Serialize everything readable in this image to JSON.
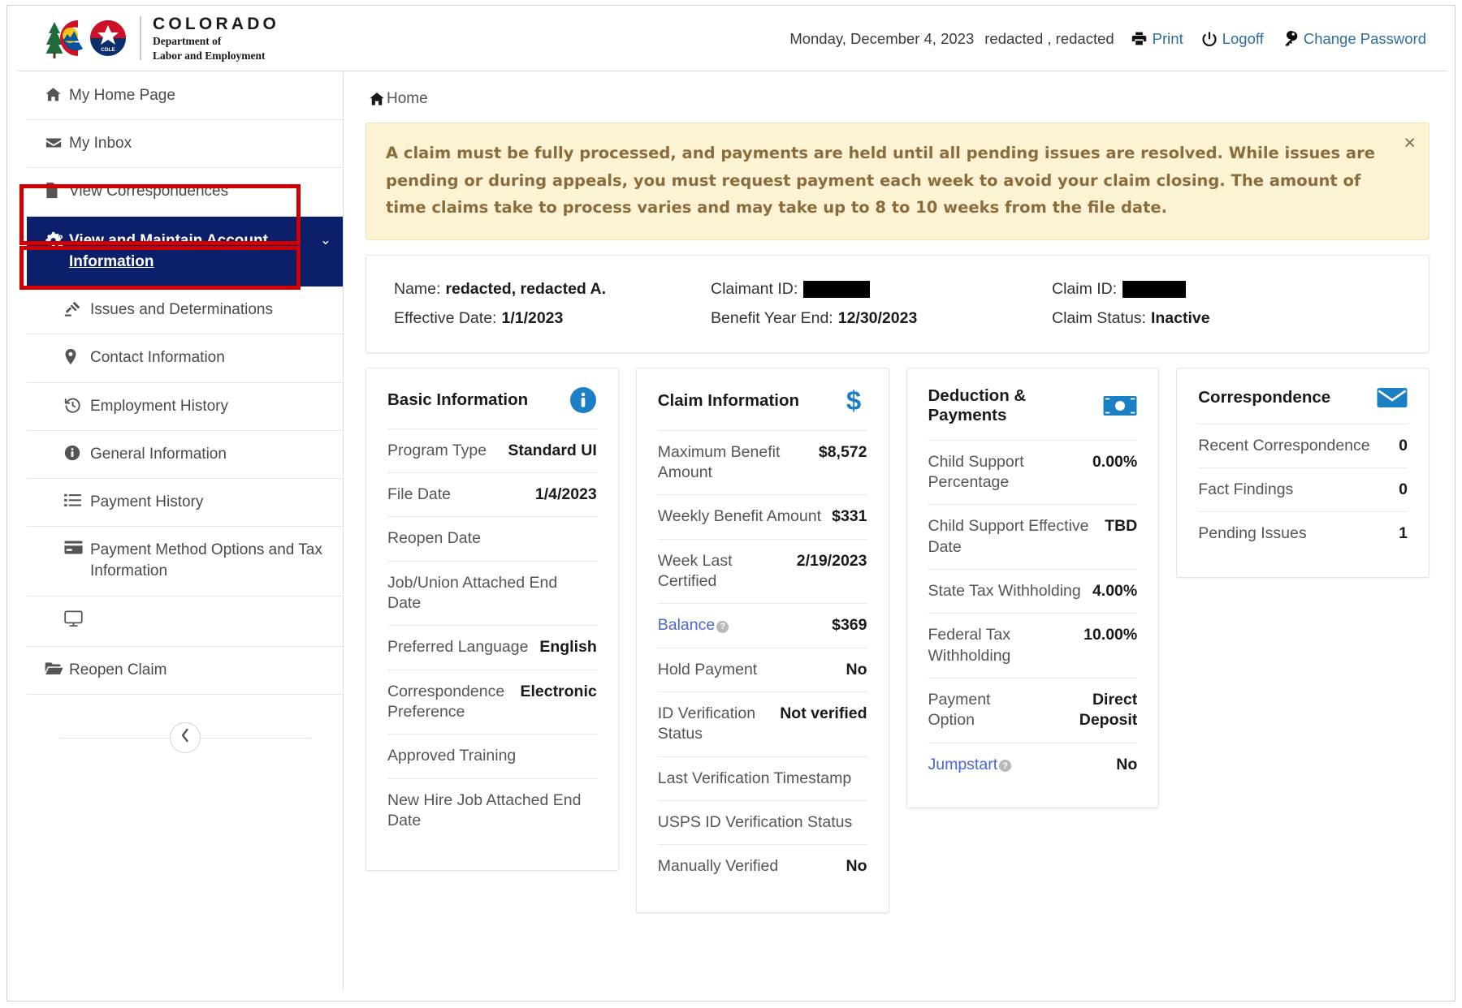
{
  "header": {
    "brand": {
      "state": "COLORADO",
      "dept_line1": "Department of",
      "dept_line2": "Labor and Employment",
      "seal_text": "CDLE"
    },
    "date": "Monday, December 4, 2023",
    "user": "redacted , redacted",
    "print_label": "Print",
    "logoff_label": "Logoff",
    "change_password_label": "Change Password"
  },
  "sidebar": {
    "items": [
      {
        "label": "My Home Page",
        "icon": "home-icon",
        "level": "top",
        "active": false
      },
      {
        "label": "My Inbox",
        "icon": "envelope-icon",
        "level": "top",
        "active": false
      },
      {
        "label": "View Correspondences",
        "icon": "file-icon",
        "level": "top",
        "active": false
      },
      {
        "label": "View and Maintain Account Information",
        "icon": "gears-icon",
        "level": "top",
        "active": true,
        "chevron": "⌄"
      },
      {
        "label": "Issues and Determinations",
        "icon": "gavel-icon",
        "level": "sub",
        "active": false
      },
      {
        "label": "Contact Information",
        "icon": "map-marker-icon",
        "level": "sub",
        "active": false
      },
      {
        "label": "Employment History",
        "icon": "history-icon",
        "level": "sub",
        "active": false
      },
      {
        "label": "General Information",
        "icon": "info-circle-icon",
        "level": "sub",
        "active": false
      },
      {
        "label": "Payment History",
        "icon": "list-icon",
        "level": "sub",
        "active": false
      },
      {
        "label": "Payment Method Options and Tax Information",
        "icon": "credit-card-icon",
        "level": "sub",
        "active": false
      },
      {
        "label": "",
        "icon": "desktop-icon",
        "level": "sub",
        "active": false
      },
      {
        "label": "Reopen Claim",
        "icon": "folder-open-icon",
        "level": "top",
        "active": false
      }
    ],
    "collapse_icon": "chevron-left-icon"
  },
  "breadcrumb": {
    "icon": "home-icon",
    "label": "Home"
  },
  "alert": {
    "text": "A claim must be fully processed, and payments are held until all pending issues are resolved. While issues are pending or during appeals, you must request payment each week to avoid your claim closing. The amount of time claims take to process varies and may take up to 8 to 10 weeks from the file date.",
    "close_label": "×"
  },
  "claim_summary": {
    "col1": [
      {
        "label": "Name:",
        "value": "redacted, redacted A."
      },
      {
        "label": "Effective Date:",
        "value": "1/1/2023"
      }
    ],
    "col2": [
      {
        "label": "Claimant ID:",
        "value": "",
        "redacted": true,
        "redacted_width": 82
      },
      {
        "label": "Benefit Year End:",
        "value": "12/30/2023"
      }
    ],
    "col3": [
      {
        "label": "Claim ID:",
        "value": "",
        "redacted": true,
        "redacted_width": 78
      },
      {
        "label": "Claim Status:",
        "value": "Inactive"
      }
    ]
  },
  "cards": {
    "basic": {
      "title": "Basic Information",
      "icon": "info-circle-icon",
      "icon_color": "#1b7fc4",
      "rows": [
        {
          "key": "Program Type",
          "value": "Standard UI"
        },
        {
          "key": "File Date",
          "value": "1/4/2023"
        },
        {
          "key": "Reopen Date",
          "value": ""
        },
        {
          "key": "Job/Union Attached End Date",
          "value": ""
        },
        {
          "key": "Preferred Language",
          "value": "English"
        },
        {
          "key": "Correspondence Preference",
          "value": "Electronic"
        },
        {
          "key": "Approved Training",
          "value": ""
        },
        {
          "key": "New Hire Job Attached End Date",
          "value": ""
        }
      ]
    },
    "claim": {
      "title": "Claim Information",
      "icon": "dollar-sign-icon",
      "icon_color": "#1b7fc4",
      "rows": [
        {
          "key": "Maximum Benefit Amount",
          "value": "$8,572"
        },
        {
          "key": "Weekly Benefit Amount",
          "value": "$331"
        },
        {
          "key": "Week Last Certified",
          "value": "2/19/2023"
        },
        {
          "key": "Balance",
          "value": "$369",
          "link": true,
          "help": "?"
        },
        {
          "key": "Hold Payment",
          "value": "No"
        },
        {
          "key": "ID Verification Status",
          "value": "Not verified"
        },
        {
          "key": "Last Verification Timestamp",
          "value": ""
        },
        {
          "key": "USPS ID Verification Status",
          "value": ""
        },
        {
          "key": "Manually Verified",
          "value": "No"
        }
      ]
    },
    "deduction": {
      "title": "Deduction & Payments",
      "icon": "money-bill-icon",
      "icon_color": "#1b7fc4",
      "rows": [
        {
          "key": "Child Support Percentage",
          "value": "0.00%"
        },
        {
          "key": "Child Support Effective Date",
          "value": "TBD"
        },
        {
          "key": "State Tax Withholding",
          "value": "4.00%"
        },
        {
          "key": "Federal Tax Withholding",
          "value": "10.00%"
        },
        {
          "key": "Payment Option",
          "value": "Direct Deposit"
        },
        {
          "key": "Jumpstart",
          "value": "No",
          "link": true,
          "help": "?"
        }
      ]
    },
    "correspondence": {
      "title": "Correspondence",
      "icon": "envelope-icon",
      "icon_color": "#1b7fc4",
      "rows": [
        {
          "key": "Recent Correspondence",
          "value": "0"
        },
        {
          "key": "Fact Findings",
          "value": "0"
        },
        {
          "key": "Pending Issues",
          "value": "1"
        }
      ]
    }
  },
  "colors": {
    "active_nav_bg": "#0b1f6b",
    "annotation_red": "#d10000",
    "alert_bg": "#fcf3d4",
    "alert_text": "#8a6d3b",
    "link_blue": "#2e6da4",
    "card_icon_blue": "#1b7fc4"
  }
}
